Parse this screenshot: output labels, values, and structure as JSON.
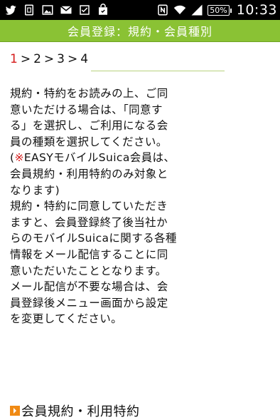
{
  "status_bar": {
    "battery": "50%",
    "time": "10:33",
    "icons_left": [
      "twitter-icon",
      "nfc-tag-icon",
      "image-icon",
      "gmail-icon",
      "checkbox-icon",
      "shopping-bag-icon"
    ],
    "icons_right": [
      "nfc-icon",
      "wifi-icon",
      "signal-icon",
      "battery-icon"
    ]
  },
  "header": {
    "title": "会員登録：規約・会員種別",
    "color": "#8ac234"
  },
  "steps": {
    "current": "1",
    "sep1": ">",
    "s2": "2",
    "sep2": ">",
    "s3": "3",
    "sep3": ">",
    "s4": "4",
    "current_color": "#d51b1b"
  },
  "body": {
    "para1": "規約・特約をお読みの上、ご同意いただける場合は、「同意する」を選択し、ご利用になる会員の種類を選択してください。",
    "note_open": "(",
    "note_mark": "※",
    "note_text": "EASYモバイルSuica会員は、会員規約・利用特約のみ対象となります)",
    "para2": "規約・特約に同意していただきますと、会員登録終了後当社からのモバイルSuicaに関する各種情報をメール配信することに同意いただいたこととなります。",
    "para3": "メール配信が不要な場合は、会員登録後メニュー画面から設定を変更してください。"
  },
  "section": {
    "heading": "会員規約・利用特約",
    "icon_color": "#f08a14"
  }
}
